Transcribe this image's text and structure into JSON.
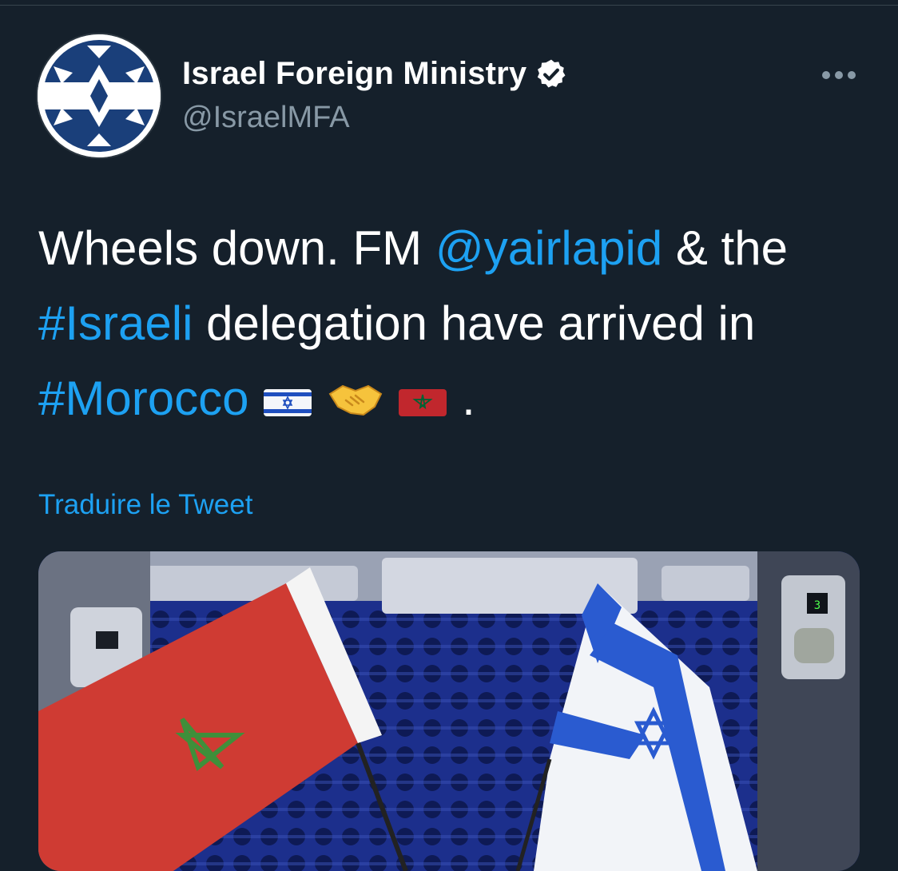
{
  "tweet": {
    "author": {
      "display_name": "Israel Foreign Ministry",
      "handle": "@IsraelMFA",
      "verified": true
    },
    "text": {
      "part1": "Wheels down. FM ",
      "mention": "@yairlapid",
      "part2": " & the",
      "hashtag1": "#Israeli",
      "part3": " delegation have arrived in",
      "hashtag2": "#Morocco",
      "emojis": [
        "israel-flag",
        "handshake",
        "morocco-flag"
      ],
      "end": "."
    },
    "translate_label": "Traduire le Tweet",
    "media": {
      "description_icons": [
        "morocco-flag",
        "israel-flag"
      ],
      "seat_display": "3"
    }
  },
  "colors": {
    "background": "#15202b",
    "link": "#1da1f2",
    "secondary_text": "#8899a6",
    "israel_blue": "#1f4fbf",
    "morocco_red": "#c1272d",
    "morocco_green": "#006233"
  }
}
